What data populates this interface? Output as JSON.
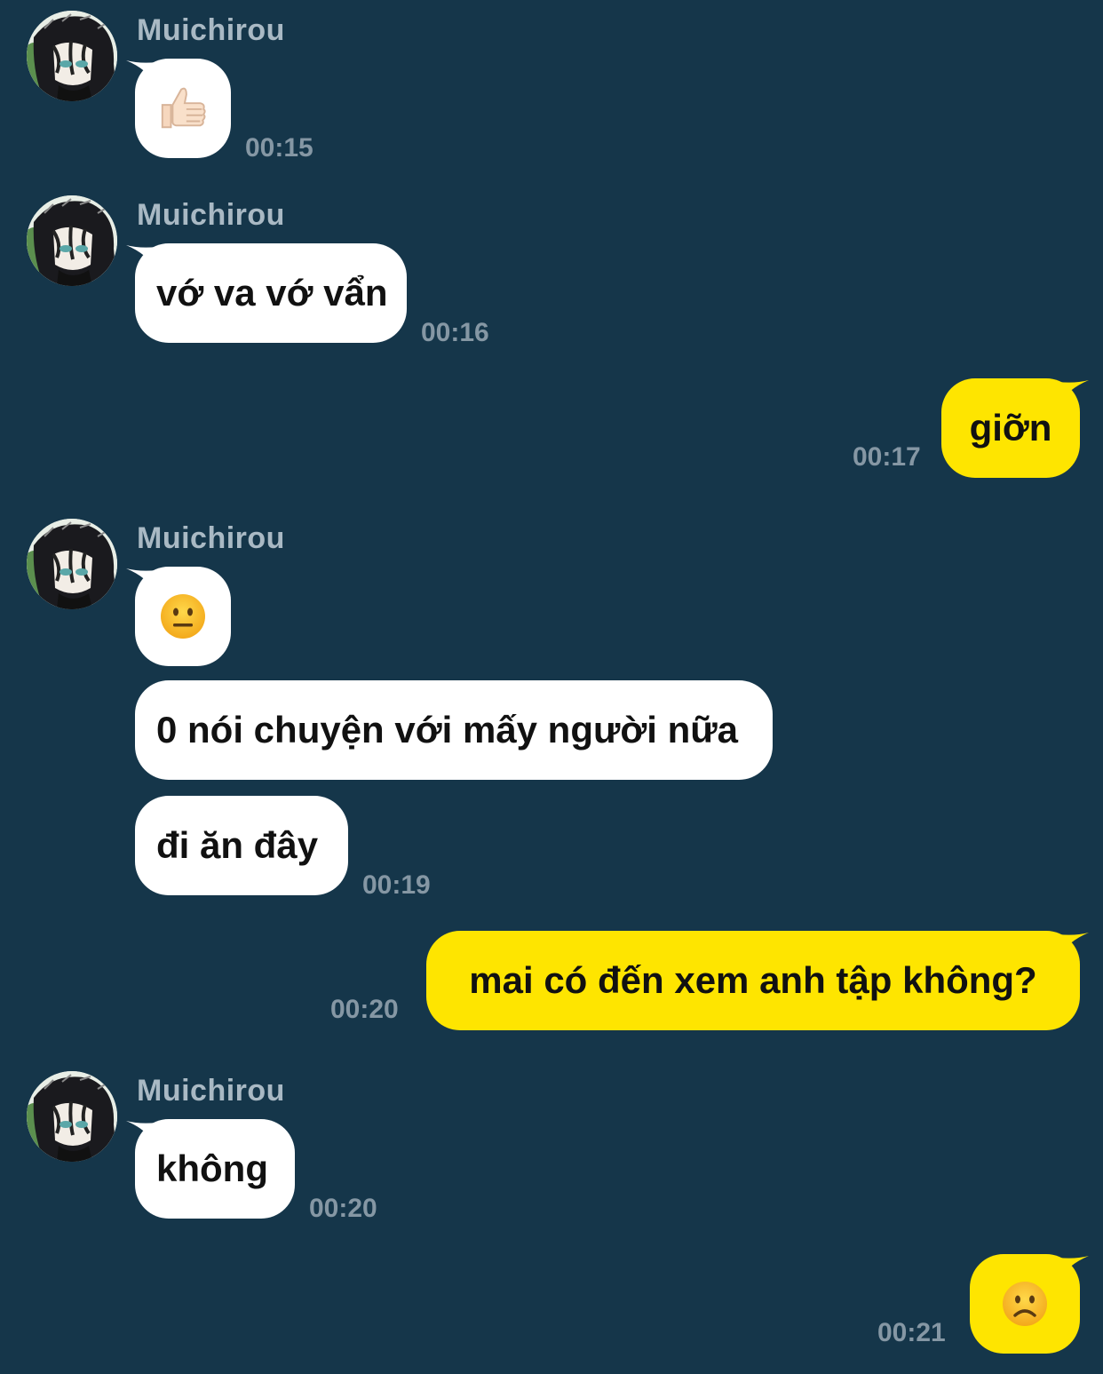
{
  "contact": {
    "name": "Muichirou",
    "avatar": "anime-avatar-icon"
  },
  "colors": {
    "background": "#15364a",
    "incoming_bubble": "#ffffff",
    "outgoing_bubble": "#fee500",
    "time": "#8597a4",
    "sender": "#a9b9c4"
  },
  "messages": [
    {
      "direction": "in",
      "sender": "Muichirou",
      "icon": "thumbs-up-icon",
      "time": "00:15"
    },
    {
      "direction": "in",
      "sender": "Muichirou",
      "text": "vớ va vớ vẩn",
      "time": "00:16"
    },
    {
      "direction": "out",
      "text": "giỡn",
      "time": "00:17"
    },
    {
      "direction": "in",
      "sender": "Muichirou",
      "icon": "neutral-face-icon"
    },
    {
      "direction": "in",
      "text": "0 nói chuyện với mấy người nữa"
    },
    {
      "direction": "in",
      "text": "đi ăn đây",
      "time": "00:19"
    },
    {
      "direction": "out",
      "text": "mai có đến xem anh tập không?",
      "time": "00:20"
    },
    {
      "direction": "in",
      "sender": "Muichirou",
      "text": "không",
      "time": "00:20"
    },
    {
      "direction": "out",
      "icon": "frowning-face-icon",
      "time": "00:21"
    }
  ]
}
